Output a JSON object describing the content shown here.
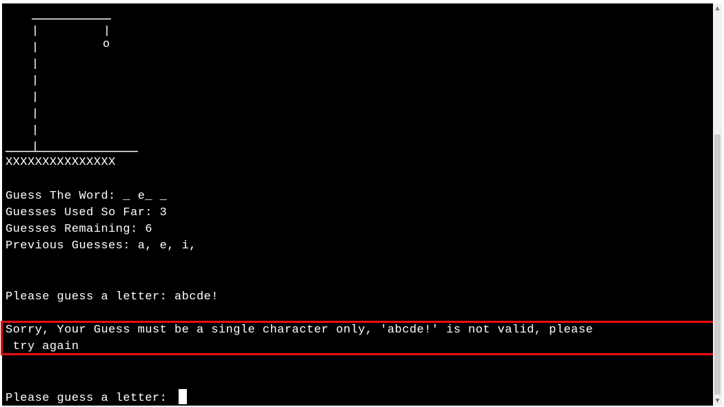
{
  "terminal": {
    "base_row": "XXXXXXXXXXXXXXX",
    "word_line": "Guess The Word: _ e_ _",
    "used_line": "Guesses Used So Far: 3",
    "remaining_line": "Guesses Remaining: 6",
    "previous_line": "Previous Guesses: a, e, i,",
    "prompt_with_input": "Please guess a letter: abcde!",
    "error_line_1": "Sorry, Your Guess must be a single character only, 'abcde!' is not valid, please",
    "error_line_2": " try again",
    "prompt_empty": "Please guess a letter: ",
    "head_glyph": "o"
  },
  "colors": {
    "terminal_bg": "#000000",
    "text": "#ffffff",
    "highlight_border": "#e81010",
    "scrollbar_track": "#f0f0f0",
    "scrollbar_thumb": "#cdcdcd"
  },
  "icons": {
    "scroll_up": "triangle-up",
    "scroll_down": "triangle-down"
  }
}
